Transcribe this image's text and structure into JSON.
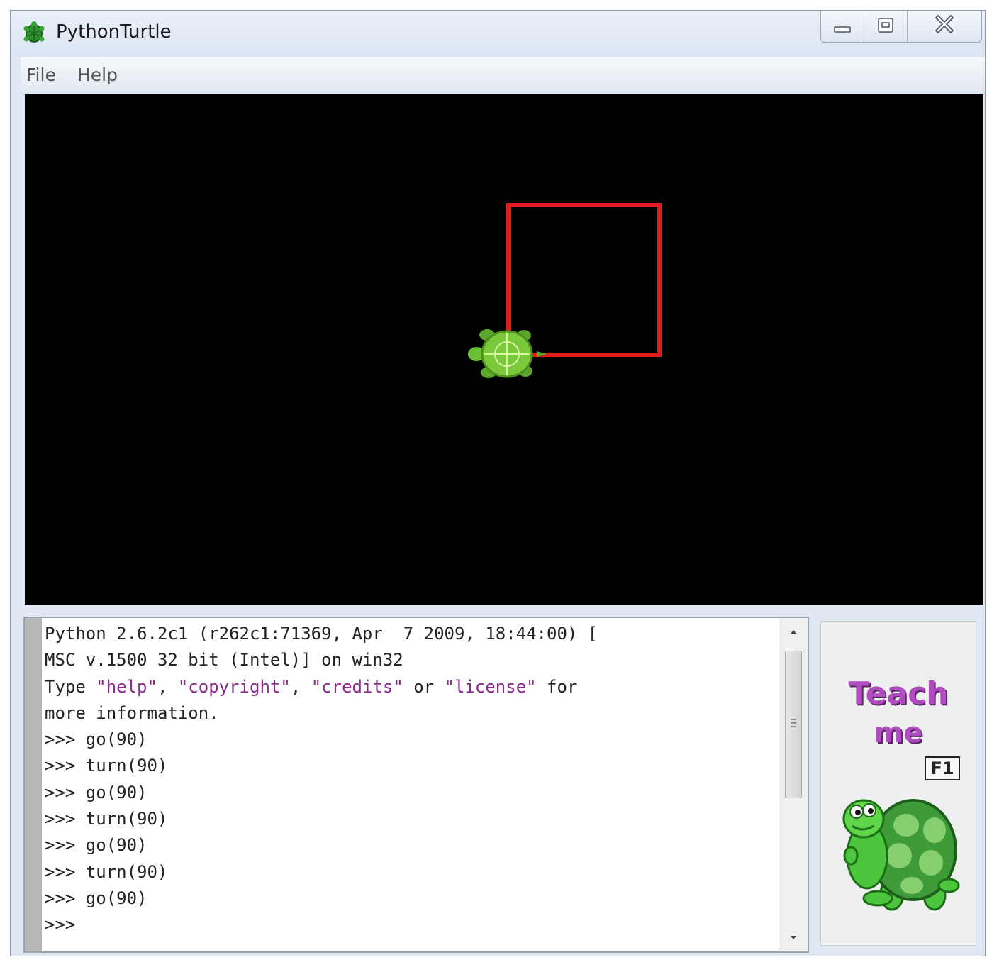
{
  "window": {
    "title": "PythonTurtle"
  },
  "menu": {
    "items": [
      "File",
      "Help"
    ]
  },
  "canvas": {
    "background": "#000000",
    "drawn_square_color": "#e11d1d",
    "turtle_color": "#7bc93a"
  },
  "shell": {
    "banner_line1": "Python 2.6.2c1 (r262c1:71369, Apr  7 2009, 18:44:00) [",
    "banner_line2": "MSC v.1500 32 bit (Intel)] on win32",
    "info_prefix": "Type ",
    "info_help": "\"help\"",
    "info_sep1": ", ",
    "info_copyright": "\"copyright\"",
    "info_sep2": ", ",
    "info_credits": "\"credits\"",
    "info_or": " or ",
    "info_license": "\"license\"",
    "info_for": " for",
    "info_line2": "more information.",
    "history": [
      ">>> go(90)",
      ">>> turn(90)",
      ">>> go(90)",
      ">>> turn(90)",
      ">>> go(90)",
      ">>> turn(90)",
      ">>> go(90)"
    ],
    "prompt": ">>>"
  },
  "teach_panel": {
    "title_line1": "Teach",
    "title_line2": "me",
    "shortcut": "F1"
  }
}
